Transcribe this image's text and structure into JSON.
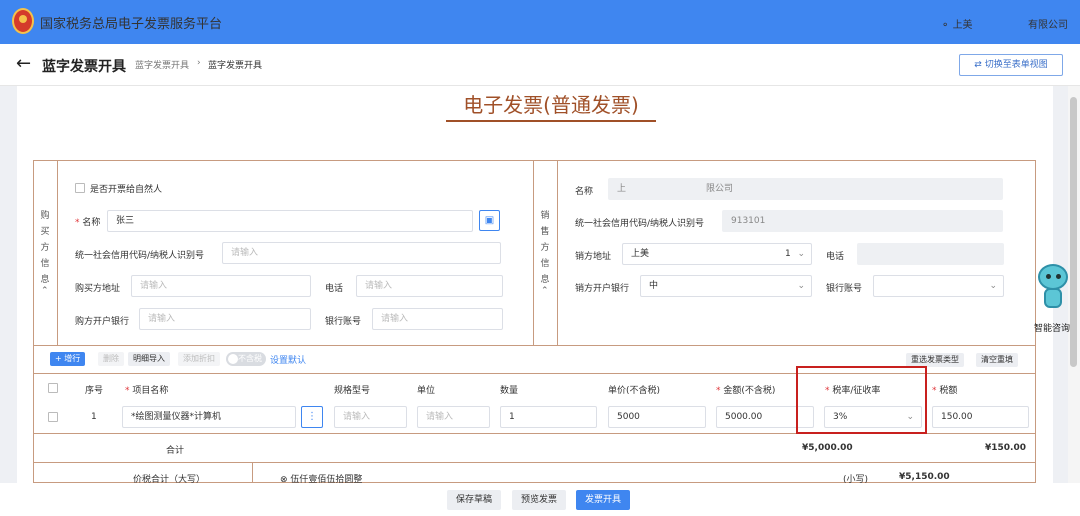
{
  "topbar": {
    "title": "国家税务总局电子发票服务平台",
    "user": "上美",
    "company": "有限公司"
  },
  "subbar": {
    "back": "←",
    "title": "蓝字发票开具",
    "crumb1": "蓝字发票开具",
    "sep": "›",
    "crumb2": "蓝字发票开具",
    "switch": "切换至表单视图"
  },
  "doc": {
    "title": "电子发票(普通发票)"
  },
  "buyer": {
    "side_label": "购买方信息",
    "natural_person": "是否开票给自然人",
    "name_label": "名称",
    "name_value": "张三",
    "tax_id_label": "统一社会信用代码/纳税人识别号",
    "tax_id_ph": "请输入",
    "addr_label": "购买方地址",
    "addr_ph": "请输入",
    "phone_label": "电话",
    "phone_ph": "请输入",
    "bank_label": "购方开户银行",
    "bank_ph": "请输入",
    "account_label": "银行账号",
    "account_ph": "请输入"
  },
  "seller": {
    "side_label": "销售方信息",
    "name_label": "名称",
    "name_value": "上",
    "name_value2": "限公司",
    "tax_id_label": "统一社会信用代码/纳税人识别号",
    "tax_id_value": "913101",
    "addr_label": "销方地址",
    "addr_value": "上美",
    "addr_suffix": "1",
    "phone_label": "电话",
    "bank_label": "销方开户银行",
    "bank_value": "中",
    "account_label": "银行账号"
  },
  "toolbar": {
    "add_row": "+ 增行",
    "delete": "删除",
    "import": "明细导入",
    "add_discount": "添加折扣",
    "tax_toggle": "不含税",
    "set_default": "设置默认",
    "reselect": "重选发票类型",
    "clear": "清空重填"
  },
  "table": {
    "headers": [
      "序号",
      "项目名称",
      "规格型号",
      "单位",
      "数量",
      "单价(不含税)",
      "金额(不含税)",
      "税率/征收率",
      "税额"
    ],
    "row": {
      "index": "1",
      "item": "*绘图测量仪器*计算机",
      "spec_ph": "请输入",
      "unit_ph": "请输入",
      "qty": "1",
      "price": "5000",
      "amount": "5000.00",
      "rate": "3%",
      "tax": "150.00"
    },
    "total_label": "合计",
    "total_amount": "¥5,000.00",
    "total_tax": "¥150.00",
    "grand_label": "价税合计（大写）",
    "grand_upper": "伍仟壹佰伍拾圆整",
    "small_label": "(小写)",
    "grand_lower": "¥5,150.00"
  },
  "footer": {
    "save": "保存草稿",
    "preview": "预览发票",
    "issue": "发票开具"
  },
  "assistant": {
    "label": "智能咨询"
  },
  "colors": {
    "primary": "#3f86f0",
    "frame": "#c79b80",
    "title": "#a05028",
    "highlight": "#c8201e"
  }
}
